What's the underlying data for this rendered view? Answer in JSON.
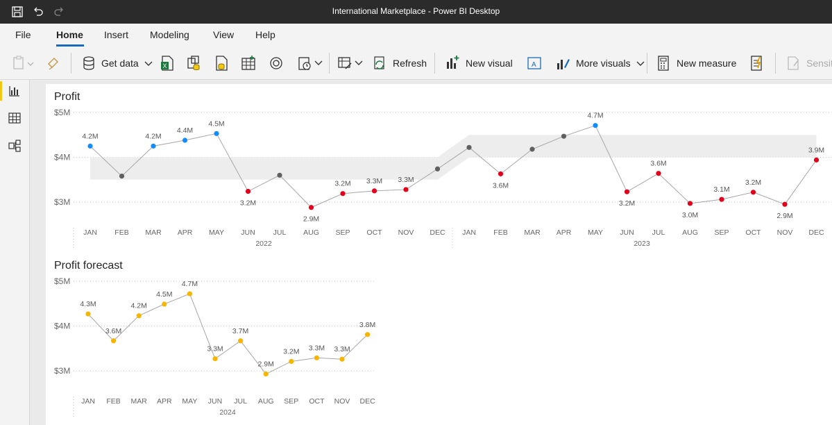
{
  "window": {
    "title": "International Marketplace - Power BI Desktop"
  },
  "menu": {
    "items": [
      {
        "label": "File"
      },
      {
        "label": "Home"
      },
      {
        "label": "Insert"
      },
      {
        "label": "Modeling"
      },
      {
        "label": "View"
      },
      {
        "label": "Help"
      }
    ],
    "active": "Home"
  },
  "toolbar": {
    "get_data": "Get data",
    "refresh": "Refresh",
    "new_visual": "New visual",
    "more_visuals": "More visuals",
    "new_measure": "New measure",
    "sensitivity": "Sensiti"
  },
  "colors": {
    "blue": "#118dff",
    "red": "#e3001b",
    "gray": "#606060",
    "yellow": "#f7b500",
    "band": "#ededed"
  },
  "chart_data": [
    {
      "type": "line",
      "title": "Profit",
      "y_ticks": [
        "$5M",
        "$4M",
        "$3M"
      ],
      "ylim": [
        3000000,
        5000000
      ],
      "x_month_labels": [
        "JAN",
        "FEB",
        "MAR",
        "APR",
        "MAY",
        "JUN",
        "JUL",
        "AUG",
        "SEP",
        "OCT",
        "NOV",
        "DEC",
        "JAN",
        "FEB",
        "MAR",
        "APR",
        "MAY",
        "JUN",
        "JUL",
        "AUG",
        "SEP",
        "OCT",
        "NOV",
        "DEC"
      ],
      "x_year_labels": [
        "2022",
        "2023"
      ],
      "values": [
        4.25,
        3.58,
        4.25,
        4.38,
        4.53,
        3.24,
        3.6,
        2.88,
        3.19,
        3.25,
        3.28,
        3.74,
        4.22,
        3.63,
        4.18,
        4.47,
        4.71,
        3.23,
        3.64,
        2.97,
        3.06,
        3.22,
        2.95,
        3.94
      ],
      "point_colors": [
        "blue",
        "gray",
        "blue",
        "blue",
        "blue",
        "red",
        "gray",
        "red",
        "red",
        "red",
        "red",
        "gray",
        "gray",
        "red",
        "gray",
        "gray",
        "blue",
        "red",
        "red",
        "red",
        "red",
        "red",
        "red",
        "red"
      ],
      "data_labels": [
        "4.2M",
        "",
        "4.2M",
        "4.4M",
        "4.5M",
        "3.2M",
        "",
        "2.9M",
        "3.2M",
        "3.3M",
        "3.3M",
        "",
        "",
        "3.6M",
        "",
        "",
        "4.7M",
        "3.2M",
        "3.6M",
        "3.0M",
        "3.1M",
        "3.2M",
        "2.9M",
        "3.9M"
      ],
      "band": {
        "2022": [
          3.5,
          4.0
        ],
        "2023": [
          4.0,
          4.5
        ]
      }
    },
    {
      "type": "line",
      "title": "Profit forecast",
      "y_ticks": [
        "$5M",
        "$4M",
        "$3M"
      ],
      "ylim": [
        3000000,
        5000000
      ],
      "x_month_labels": [
        "JAN",
        "FEB",
        "MAR",
        "APR",
        "MAY",
        "JUN",
        "JUL",
        "AUG",
        "SEP",
        "OCT",
        "NOV",
        "DEC"
      ],
      "x_year_labels": [
        "2024"
      ],
      "values": [
        4.27,
        3.67,
        4.23,
        4.49,
        4.72,
        3.27,
        3.67,
        2.93,
        3.21,
        3.29,
        3.26,
        3.81
      ],
      "data_labels": [
        "4.3M",
        "3.6M",
        "4.2M",
        "4.5M",
        "4.7M",
        "3.3M",
        "3.7M",
        "2.9M",
        "3.2M",
        "3.3M",
        "3.3M",
        "3.8M"
      ]
    }
  ]
}
